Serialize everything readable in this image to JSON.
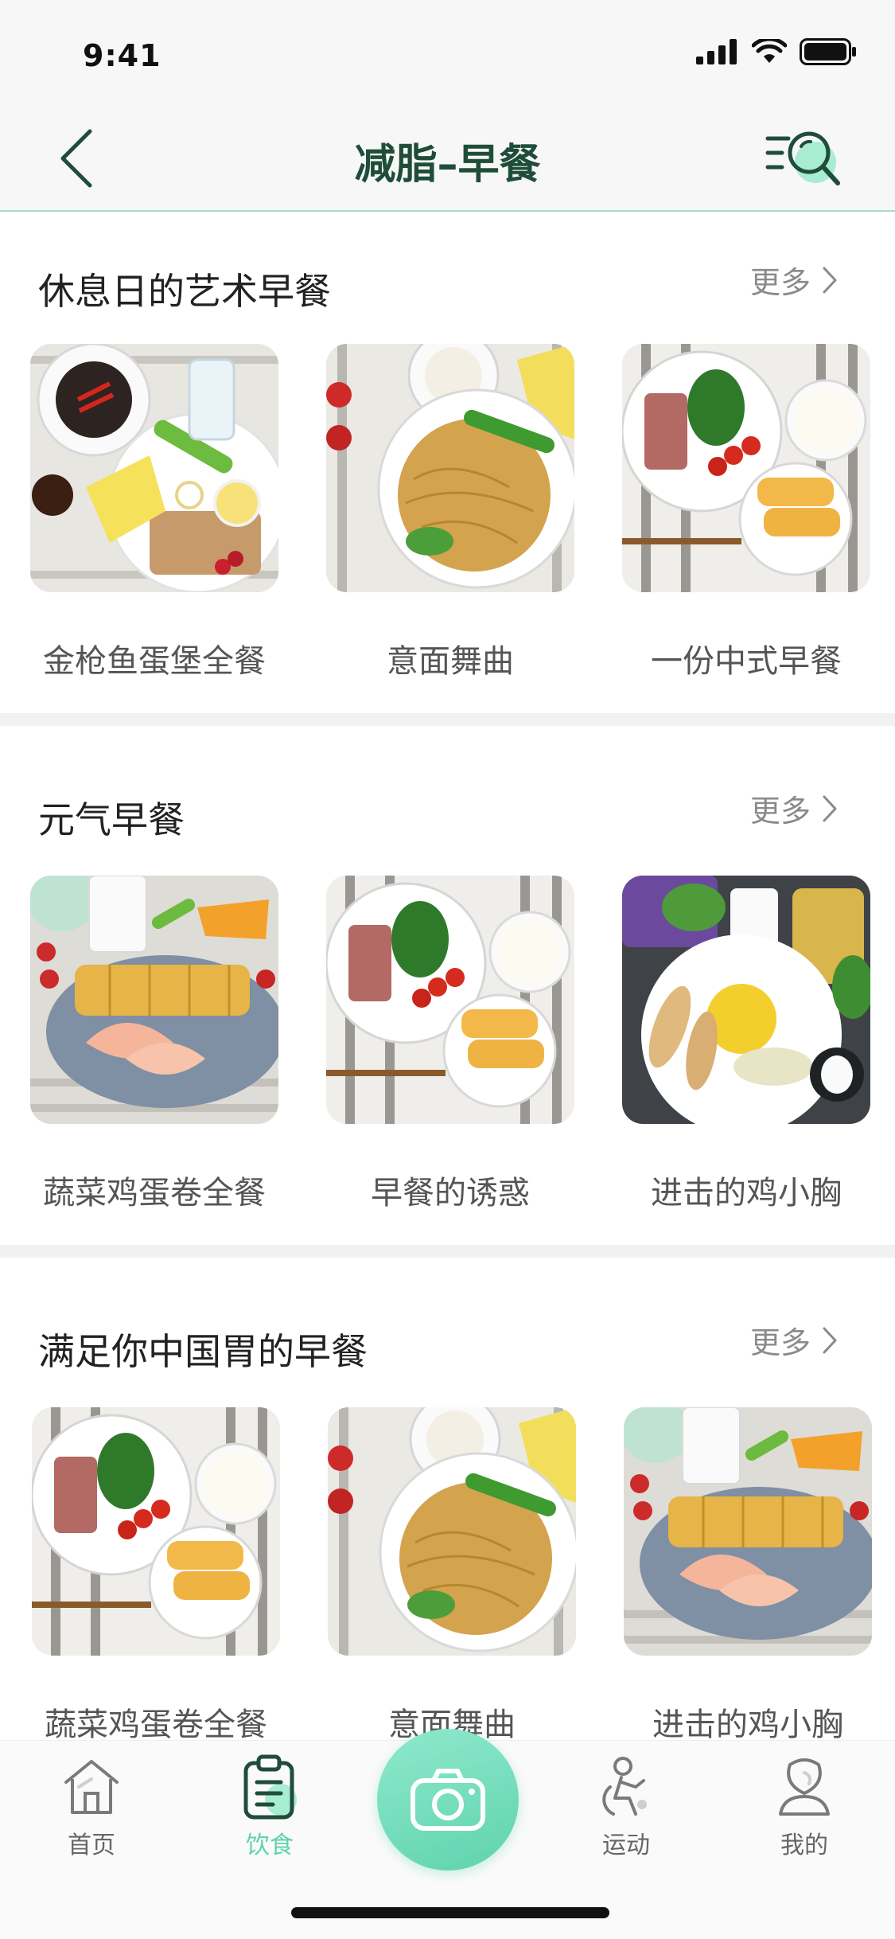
{
  "status_bar": {
    "time": "9:41"
  },
  "nav": {
    "title": "减脂–早餐"
  },
  "sections": [
    {
      "title": "休息日的艺术早餐",
      "more": "更多",
      "items": [
        {
          "label": "金枪鱼蛋堡全餐"
        },
        {
          "label": "意面舞曲"
        },
        {
          "label": "一份中式早餐"
        }
      ]
    },
    {
      "title": "元气早餐",
      "more": "更多",
      "items": [
        {
          "label": "蔬菜鸡蛋卷全餐"
        },
        {
          "label": "早餐的诱惑"
        },
        {
          "label": "进击的鸡小胸"
        }
      ]
    },
    {
      "title": "满足你中国胃的早餐",
      "more": "更多",
      "items": [
        {
          "label": "蔬菜鸡蛋卷全餐"
        },
        {
          "label": "意面舞曲"
        },
        {
          "label": "进击的鸡小胸"
        }
      ]
    }
  ],
  "tab_bar": {
    "tabs": [
      {
        "label": "首页",
        "icon": "home-icon"
      },
      {
        "label": "饮食",
        "icon": "clipboard-icon",
        "active": true
      },
      {
        "label": "运动",
        "icon": "exercise-icon"
      },
      {
        "label": "我的",
        "icon": "profile-icon"
      }
    ],
    "center_icon": "camera-icon"
  },
  "colors": {
    "accent": "#5fd3ad",
    "title": "#1f4d3a",
    "muted": "#8a8a8a"
  }
}
